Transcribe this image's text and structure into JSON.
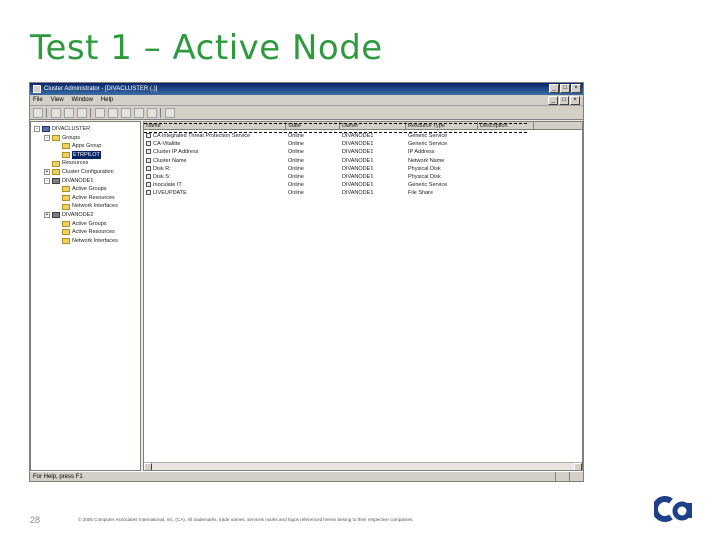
{
  "slide": {
    "title": "Test 1 – Active Node",
    "page_number": "28",
    "copyright": "© 2005 Computer Associates International, Inc. (CA). All trademarks, trade names, services marks and logos referenced herein belong to their respective companies.",
    "title_color": "#2e9a3e"
  },
  "window": {
    "title": "Cluster Administrator - [DIVACLUSTER (.)]",
    "controls": [
      "_",
      "□",
      "×"
    ],
    "menu": [
      "File",
      "View",
      "Window",
      "Help"
    ],
    "mdi_controls": [
      "_",
      "□",
      "×"
    ],
    "status": "For Help, press F1"
  },
  "tree": [
    {
      "label": "DIVACLUSTER",
      "icon": "cluster-icon",
      "expander": "-",
      "level": 0
    },
    {
      "label": "Groups",
      "icon": "folder-icon",
      "expander": "-",
      "level": 1
    },
    {
      "label": "Apps Group",
      "icon": "folder-icon",
      "expander": "",
      "level": 2
    },
    {
      "label": "ETRPILOT",
      "icon": "folder-icon",
      "expander": "",
      "level": 2,
      "selected": true
    },
    {
      "label": "Resources",
      "icon": "folder-icon",
      "expander": "",
      "level": 1
    },
    {
      "label": "Cluster Configuration",
      "icon": "folder-icon",
      "expander": "+",
      "level": 1
    },
    {
      "label": "DIVANODE1",
      "icon": "node-icon",
      "expander": "-",
      "level": 1
    },
    {
      "label": "Active Groups",
      "icon": "folder-icon",
      "expander": "",
      "level": 2
    },
    {
      "label": "Active Resources",
      "icon": "folder-icon",
      "expander": "",
      "level": 2
    },
    {
      "label": "Network Interfaces",
      "icon": "folder-icon",
      "expander": "",
      "level": 2
    },
    {
      "label": "DIVANODE2",
      "icon": "node-icon",
      "expander": "+",
      "level": 1
    },
    {
      "label": "Active Groups",
      "icon": "folder-icon",
      "expander": "",
      "level": 2
    },
    {
      "label": "Active Resources",
      "icon": "folder-icon",
      "expander": "",
      "level": 2
    },
    {
      "label": "Network Interfaces",
      "icon": "folder-icon",
      "expander": "",
      "level": 2
    }
  ],
  "list": {
    "columns": [
      "Name",
      "State",
      "Owner",
      "Resource Type",
      "Description"
    ],
    "rows": [
      [
        "CA Integrated Threat Protection Service",
        "Online",
        "DIVANODE1",
        "Generic Service",
        ""
      ],
      [
        "CA-Vitalitte",
        "Online",
        "DIVANODE1",
        "Generic Service",
        ""
      ],
      [
        "Cluster IP Address",
        "Online",
        "DIVANODE1",
        "IP Address",
        ""
      ],
      [
        "Cluster Name",
        "Online",
        "DIVANODE1",
        "Network Name",
        ""
      ],
      [
        "Disk R:",
        "Online",
        "DIVANODE1",
        "Physical Disk",
        ""
      ],
      [
        "Disk S:",
        "Online",
        "DIVANODE1",
        "Physical Disk",
        ""
      ],
      [
        "Inoculate IT",
        "Online",
        "DIVANODE1",
        "Generic Service",
        ""
      ],
      [
        "LIVEUPDATE",
        "Online",
        "DIVANODE1",
        "File Share",
        ""
      ]
    ]
  }
}
